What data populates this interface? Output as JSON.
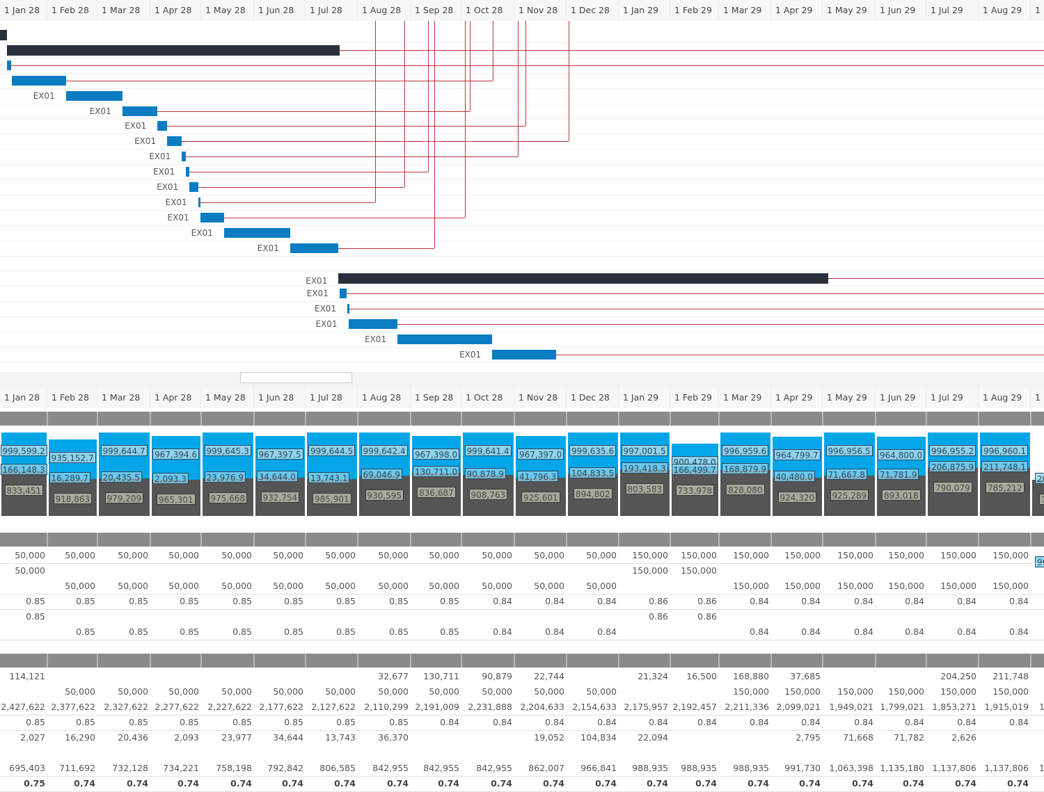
{
  "months": [
    "1 Jan 28",
    "1 Feb 28",
    "1 Mar 28",
    "1 Apr 28",
    "1 May 28",
    "1 Jun 28",
    "1 Jul 28",
    "1 Aug 28",
    "1 Sep 28",
    "1 Oct 28",
    "1 Nov 28",
    "1 Dec 28",
    "1 Jan 29",
    "1 Feb 29",
    "1 Mar 29",
    "1 Apr 29",
    "1 May 29",
    "1 Jun 29",
    "1 Jul 29",
    "1 Aug 29",
    "1"
  ],
  "colors": {
    "task_bar": "#0a7cc1",
    "summary_bar": "#2b2f3d",
    "dependency_line": "#b5393c",
    "capacity_fill": "#05a6e8",
    "load_fill": "#555555"
  },
  "gantt": {
    "task_label": "EX01",
    "tasks": [
      {
        "label": "",
        "type": "summary",
        "start_month": 0.0,
        "end_month": 0.15
      },
      {
        "label": "",
        "type": "summary",
        "start_month": 0.15,
        "end_month": 6.65
      },
      {
        "label": "",
        "type": "task",
        "start_month": 0.15,
        "end_month": 0.24
      },
      {
        "label": "",
        "type": "task",
        "start_month": 0.25,
        "end_month": 1.37
      },
      {
        "label": "EX01",
        "type": "task",
        "start_month": 1.37,
        "end_month": 2.47
      },
      {
        "label": "EX01",
        "type": "task",
        "start_month": 2.47,
        "end_month": 3.14
      },
      {
        "label": "EX01",
        "type": "task",
        "start_month": 3.14,
        "end_month": 3.33
      },
      {
        "label": "EX01",
        "type": "task",
        "start_month": 3.33,
        "end_month": 3.62
      },
      {
        "label": "EX01",
        "type": "task",
        "start_month": 3.62,
        "end_month": 3.7
      },
      {
        "label": "EX01",
        "type": "task",
        "start_month": 3.7,
        "end_month": 3.77
      },
      {
        "label": "EX01",
        "type": "task",
        "start_month": 3.77,
        "end_month": 3.94
      },
      {
        "label": "EX01",
        "type": "task",
        "start_month": 3.94,
        "end_month": 3.97
      },
      {
        "label": "EX01",
        "type": "task",
        "start_month": 3.98,
        "end_month": 4.43
      },
      {
        "label": "EX01",
        "type": "task",
        "start_month": 4.43,
        "end_month": 5.7
      },
      {
        "label": "EX01",
        "type": "task",
        "start_month": 5.7,
        "end_month": 6.63
      },
      {
        "label": "",
        "type": "spacer"
      },
      {
        "label": "EX01",
        "type": "summary",
        "start_month": 6.63,
        "end_month": 16.1
      },
      {
        "label": "EX01",
        "type": "task",
        "start_month": 6.65,
        "end_month": 6.78
      },
      {
        "label": "EX01",
        "type": "task",
        "start_month": 6.8,
        "end_month": 6.82
      },
      {
        "label": "EX01",
        "type": "task",
        "start_month": 6.82,
        "end_month": 7.75
      },
      {
        "label": "EX01",
        "type": "task",
        "start_month": 7.75,
        "end_month": 9.58
      },
      {
        "label": "EX01",
        "type": "task",
        "start_month": 9.58,
        "end_month": 10.8
      }
    ]
  },
  "capacity_chart": {
    "columns": [
      {
        "month": "1 Jan 28",
        "capacity": "999,599.2",
        "demand": "166,148.3",
        "remaining": "833,451"
      },
      {
        "month": "1 Feb 28",
        "capacity": "935,152.7",
        "demand": "16,289.7",
        "remaining": "918,863"
      },
      {
        "month": "1 Mar 28",
        "capacity": "999,644.7",
        "demand": "20,435.5",
        "remaining": "979,209"
      },
      {
        "month": "1 Apr 28",
        "capacity": "967,394.6",
        "demand": "2,093.3",
        "remaining": "965,301"
      },
      {
        "month": "1 May 28",
        "capacity": "999,645.3",
        "demand": "23,976.9",
        "remaining": "975,668"
      },
      {
        "month": "1 Jun 28",
        "capacity": "967,397.5",
        "demand": "34,644.0",
        "remaining": "932,754"
      },
      {
        "month": "1 Jul 28",
        "capacity": "999,644.5",
        "demand": "13,743.1",
        "remaining": "985,901"
      },
      {
        "month": "1 Aug 28",
        "capacity": "999,642.4",
        "demand": "69,046.9",
        "remaining": "930,595"
      },
      {
        "month": "1 Sep 28",
        "capacity": "967,398.0",
        "demand": "130,711.0",
        "remaining": "836,687"
      },
      {
        "month": "1 Oct 28",
        "capacity": "999,641.4",
        "demand": "90,878.9",
        "remaining": "908,763"
      },
      {
        "month": "1 Nov 28",
        "capacity": "967,397.0",
        "demand": "41,796.3",
        "remaining": "925,601"
      },
      {
        "month": "1 Dec 28",
        "capacity": "999,635.6",
        "demand": "104,833.5",
        "remaining": "894,802"
      },
      {
        "month": "1 Jan 29",
        "capacity": "997,001.5",
        "demand": "193,418.3",
        "remaining": "803,583"
      },
      {
        "month": "1 Feb 29",
        "capacity": "900,478.0",
        "demand": "166,499.7",
        "remaining": "733,978"
      },
      {
        "month": "1 Mar 29",
        "capacity": "996,959.6",
        "demand": "168,879.9",
        "remaining": "828,080"
      },
      {
        "month": "1 Apr 29",
        "capacity": "964,799.7",
        "demand": "40,480.0",
        "remaining": "924,320"
      },
      {
        "month": "1 May 29",
        "capacity": "996,956.5",
        "demand": "71,667.8",
        "remaining": "925,289"
      },
      {
        "month": "1 Jun 29",
        "capacity": "964,800.0",
        "demand": "71,781.9",
        "remaining": "893,018"
      },
      {
        "month": "1 Jul 29",
        "capacity": "996,955.2",
        "demand": "206,875.9",
        "remaining": "790,079"
      },
      {
        "month": "1 Aug 29",
        "capacity": "996,960.1",
        "demand": "211,748.1",
        "remaining": "785,212"
      },
      {
        "month": "1",
        "capacity": "96",
        "demand": "20",
        "remaining": "7"
      }
    ]
  },
  "table1": {
    "rows": [
      {
        "style": "lined",
        "values": [
          "50,000",
          "50,000",
          "50,000",
          "50,000",
          "50,000",
          "50,000",
          "50,000",
          "50,000",
          "50,000",
          "50,000",
          "50,000",
          "50,000",
          "150,000",
          "150,000",
          "150,000",
          "150,000",
          "150,000",
          "150,000",
          "150,000",
          "150,000"
        ]
      },
      {
        "style": "",
        "values": [
          "50,000",
          "",
          "",
          "",
          "",
          "",
          "",
          "",
          "",
          "",
          "",
          "",
          "150,000",
          "150,000",
          "",
          "",
          "",
          "",
          "",
          ""
        ]
      },
      {
        "style": "lined",
        "values": [
          "",
          "50,000",
          "50,000",
          "50,000",
          "50,000",
          "50,000",
          "50,000",
          "50,000",
          "50,000",
          "50,000",
          "50,000",
          "50,000",
          "",
          "",
          "150,000",
          "150,000",
          "150,000",
          "150,000",
          "150,000",
          "150,000"
        ]
      },
      {
        "style": "lined",
        "values": [
          "0.85",
          "0.85",
          "0.85",
          "0.85",
          "0.85",
          "0.85",
          "0.85",
          "0.85",
          "0.85",
          "0.84",
          "0.84",
          "0.84",
          "0.86",
          "0.86",
          "0.84",
          "0.84",
          "0.84",
          "0.84",
          "0.84",
          "0.84"
        ]
      },
      {
        "style": "",
        "values": [
          "0.85",
          "",
          "",
          "",
          "",
          "",
          "",
          "",
          "",
          "",
          "",
          "",
          "0.86",
          "0.86",
          "",
          "",
          "",
          "",
          "",
          ""
        ]
      },
      {
        "style": "lined",
        "values": [
          "",
          "0.85",
          "0.85",
          "0.85",
          "0.85",
          "0.85",
          "0.85",
          "0.85",
          "0.85",
          "0.84",
          "0.84",
          "0.84",
          "",
          "",
          "0.84",
          "0.84",
          "0.84",
          "0.84",
          "0.84",
          "0.84"
        ]
      }
    ]
  },
  "table2": {
    "rows": [
      {
        "style": "",
        "values": [
          "114,121",
          "",
          "",
          "",
          "",
          "",
          "",
          "32,677",
          "130,711",
          "90,879",
          "22,744",
          "",
          "21,324",
          "16,500",
          "168,880",
          "37,685",
          "",
          "",
          "204,250",
          "211,748"
        ]
      },
      {
        "style": "",
        "values": [
          "",
          "50,000",
          "50,000",
          "50,000",
          "50,000",
          "50,000",
          "50,000",
          "50,000",
          "50,000",
          "50,000",
          "50,000",
          "50,000",
          "",
          "",
          "150,000",
          "150,000",
          "150,000",
          "150,000",
          "150,000",
          "150,000"
        ]
      },
      {
        "style": "lined",
        "values": [
          "2,427,622",
          "2,377,622",
          "2,327,622",
          "2,277,622",
          "2,227,622",
          "2,177,622",
          "2,127,622",
          "2,110,299",
          "2,191,009",
          "2,231,888",
          "2,204,633",
          "2,154,633",
          "2,175,957",
          "2,192,457",
          "2,211,336",
          "2,099,021",
          "1,949,021",
          "1,799,021",
          "1,853,271",
          "1,915,019",
          "1"
        ]
      },
      {
        "style": "lined",
        "values": [
          "0.85",
          "0.85",
          "0.85",
          "0.85",
          "0.85",
          "0.85",
          "0.85",
          "0.85",
          "0.84",
          "0.84",
          "0.84",
          "0.84",
          "0.84",
          "0.84",
          "0.84",
          "0.84",
          "0.84",
          "0.84",
          "0.84",
          "0.84"
        ]
      },
      {
        "style": "",
        "values": [
          "2,027",
          "16,290",
          "20,436",
          "2,093",
          "23,977",
          "34,644",
          "13,743",
          "36,370",
          "",
          "",
          "19,052",
          "104,834",
          "22,094",
          "",
          "",
          "2,795",
          "71,668",
          "71,782",
          "2,626",
          ""
        ]
      },
      {
        "style": "",
        "values": []
      },
      {
        "style": "lined",
        "values": [
          "695,403",
          "711,692",
          "732,128",
          "734,221",
          "758,198",
          "792,842",
          "806,585",
          "842,955",
          "842,955",
          "842,955",
          "862,007",
          "966,841",
          "988,935",
          "988,935",
          "988,935",
          "991,730",
          "1,063,398",
          "1,135,180",
          "1,137,806",
          "1,137,806",
          "1"
        ]
      },
      {
        "style": "lined bold",
        "values": [
          "0.75",
          "0.74",
          "0.74",
          "0.74",
          "0.74",
          "0.74",
          "0.74",
          "0.74",
          "0.74",
          "0.74",
          "0.74",
          "0.74",
          "0.74",
          "0.74",
          "0.74",
          "0.74",
          "0.74",
          "0.74",
          "0.74",
          "0.74"
        ]
      }
    ]
  }
}
